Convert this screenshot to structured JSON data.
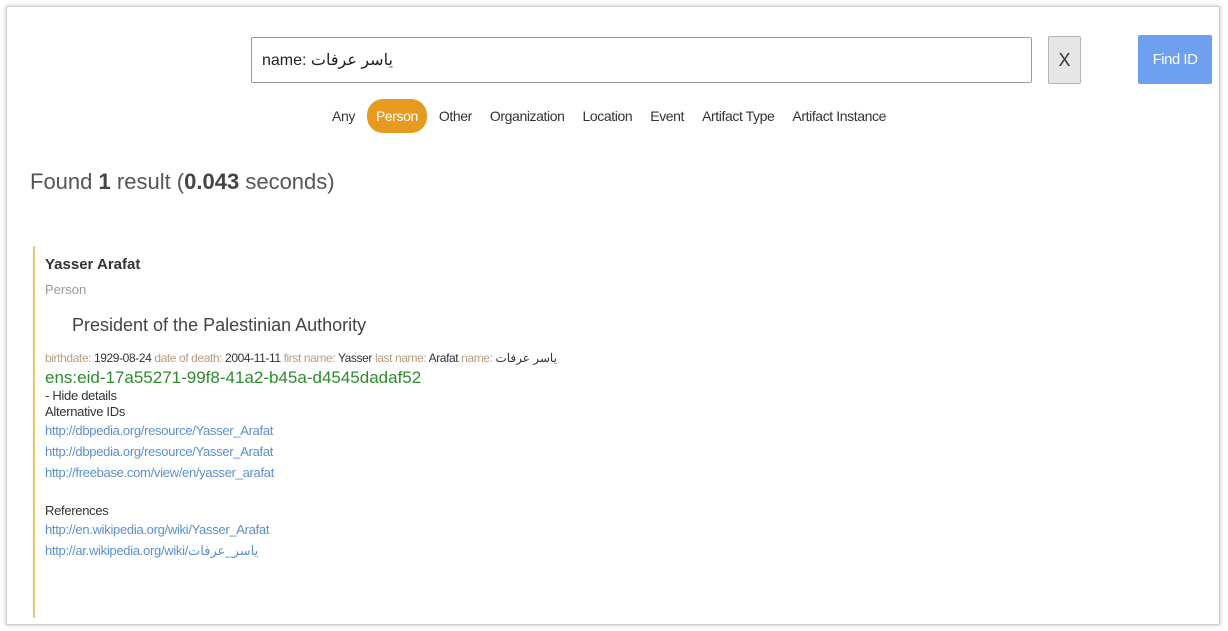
{
  "search": {
    "value": "name: ياسر عرفات",
    "clear_label": "X",
    "find_label": "Find ID"
  },
  "filters": [
    "Any",
    "Person",
    "Other",
    "Organization",
    "Location",
    "Event",
    "Artifact Type",
    "Artifact Instance"
  ],
  "active_filter": "Person",
  "results_summary": {
    "prefix": "Found",
    "count": "1",
    "middle": "result (",
    "seconds": "0.043",
    "suffix": "seconds)"
  },
  "result": {
    "name": "Yasser Arafat",
    "type": "Person",
    "description": "President of the Palestinian Authority",
    "props": {
      "birthdate_key": "birthdate:",
      "birthdate": "1929-08-24",
      "death_key": "date of death:",
      "death": "2004-11-11",
      "first_key": "first name:",
      "first": "Yasser",
      "last_key": "last name:",
      "last": "Arafat",
      "name_key": "name:",
      "name": "ياسر عرفات"
    },
    "ens_id": "ens:eid-17a55271-99f8-41a2-b45a-d4545dadaf52",
    "hide_details": "- Hide details",
    "alt_ids_title": "Alternative IDs",
    "alt_ids": [
      "http://dbpedia.org/resource/Yasser_Arafat",
      "http://dbpedia.org/resource/Yasser_Arafat",
      "http://freebase.com/view/en/yasser_arafat"
    ],
    "references_title": "References",
    "references": [
      "http://en.wikipedia.org/wiki/Yasser_Arafat",
      "http://ar.wikipedia.org/wiki/ياسر_عرفات"
    ]
  },
  "colors": {
    "accent": "#e69a1f",
    "button": "#6e9ff0",
    "ens": "#2f8a2f",
    "link": "#5b8fd0",
    "key": "#b89b7c"
  }
}
